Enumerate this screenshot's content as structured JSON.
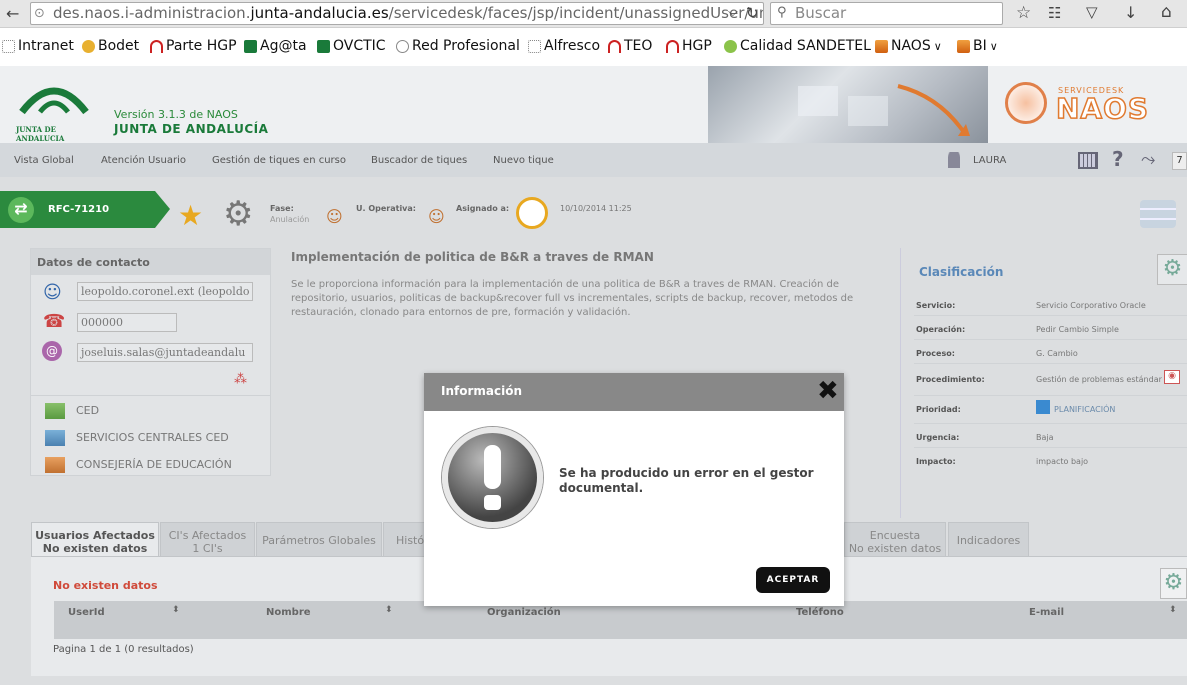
{
  "browser": {
    "url_prefix": "des.naos.i-administracion.",
    "url_domain": "junta-andalucia.es",
    "url_path": "/servicedesk/faces/jsp/incident/unassignedUser/unassigne",
    "search_placeholder": "Buscar",
    "bookmarks": [
      "Intranet",
      "Bodet",
      "Parte HGP",
      "Ag@ta",
      "OVCTIC",
      "Red Profesional",
      "Alfresco",
      "TEO",
      "HGP",
      "Calidad SANDETEL",
      "NAOS",
      "BI"
    ]
  },
  "header": {
    "logo_text": "JUNTA DE ANDALUCIA",
    "version": "Versión 3.1.3 de NAOS",
    "org": "JUNTA DE ANDALUCÍA",
    "brand_top": "SERVICEDESK",
    "brand": "NAOS"
  },
  "nav": {
    "items": [
      "Vista Global",
      "Atención Usuario",
      "Gestión de tiques en curso",
      "Buscador de tiques",
      "Nuevo tique"
    ],
    "user": "LAURA",
    "badge": "7"
  },
  "ticket": {
    "id": "RFC-71210",
    "fase_label": "Fase:",
    "fase_value": "Anulación",
    "u_operativa_label": "U. Operativa:",
    "asignado_label": "Asignado a:",
    "date": "10/10/2014 11:25"
  },
  "contact": {
    "title": "Datos de contacto",
    "user": "leopoldo.coronel.ext (leopoldo",
    "phone": "000000",
    "email": "joseluis.salas@juntadeandalu",
    "orgs": [
      "CED",
      "SERVICIOS CENTRALES CED",
      "CONSEJERÍA DE EDUCACIÓN"
    ]
  },
  "description": {
    "title": "Implementación de politica de B&R a traves de RMAN",
    "body": "Se le proporciona información para la implementación de una politica de B&R a traves de RMAN. Creación de repositorio, usuarios, politicas de backup&recover full vs incrementales, scripts de backup, recover, metodos de restauración, clonado para entornos de pre, formación y validación."
  },
  "classification": {
    "title": "Clasificación",
    "rows": [
      {
        "k": "Servicio:",
        "v": "Servicio Corporativo Oracle"
      },
      {
        "k": "Operación:",
        "v": "Pedir Cambio Simple"
      },
      {
        "k": "Proceso:",
        "v": "G. Cambio"
      },
      {
        "k": "Procedimiento:",
        "v": "Gestión de problemas estándar"
      },
      {
        "k": "Prioridad:",
        "v": "PLANIFICACIÓN"
      },
      {
        "k": "Urgencia:",
        "v": "Baja"
      },
      {
        "k": "Impacto:",
        "v": "impacto bajo"
      }
    ]
  },
  "tabs": {
    "t0a": "Usuarios Afectados",
    "t0b": "No existen datos",
    "t1a": "CI's Afectados",
    "t1b": "1 CI's",
    "t2": "Parámetros Globales",
    "t3": "Histó",
    "t4a": "Encuesta",
    "t4b": "No existen datos",
    "t5": "Indicadores"
  },
  "table": {
    "empty": "No existen datos",
    "columns": [
      "UserId",
      "Nombre",
      "Organización",
      "Teléfono",
      "E-mail"
    ],
    "pagination": "Pagina 1 de 1 (0 resultados)"
  },
  "modal": {
    "title": "Información",
    "message": "Se ha producido un error en el gestor documental.",
    "accept": "ACEPTAR"
  }
}
